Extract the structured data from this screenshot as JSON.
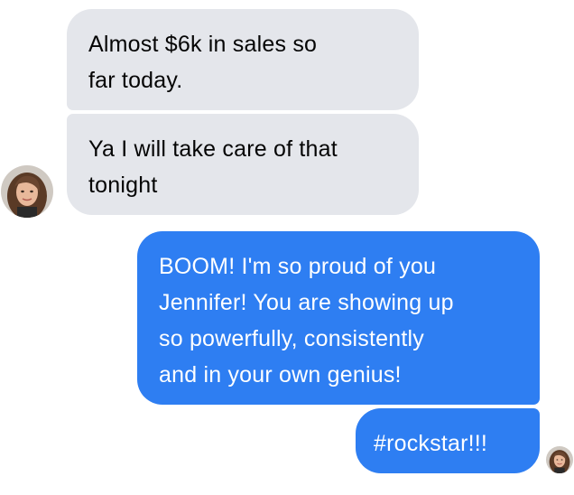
{
  "messages": [
    {
      "sender": "contact",
      "text": "Almost $6k in sales so\nfar today."
    },
    {
      "sender": "contact",
      "text": "Ya I will take care of that\ntonight"
    },
    {
      "sender": "self",
      "text": "BOOM! I'm so proud of you\nJennifer! You are showing up\nso powerfully, consistently\nand in your own genius!"
    },
    {
      "sender": "self",
      "text": "#rockstar!!!"
    }
  ],
  "colors": {
    "incoming_bubble": "#e4e6eb",
    "outgoing_bubble": "#2e7ef2",
    "incoming_text": "#050505",
    "outgoing_text": "#ffffff"
  },
  "avatars": {
    "contact_avatar": "profile-photo-icon",
    "read_receipt_avatar": "profile-photo-icon"
  }
}
